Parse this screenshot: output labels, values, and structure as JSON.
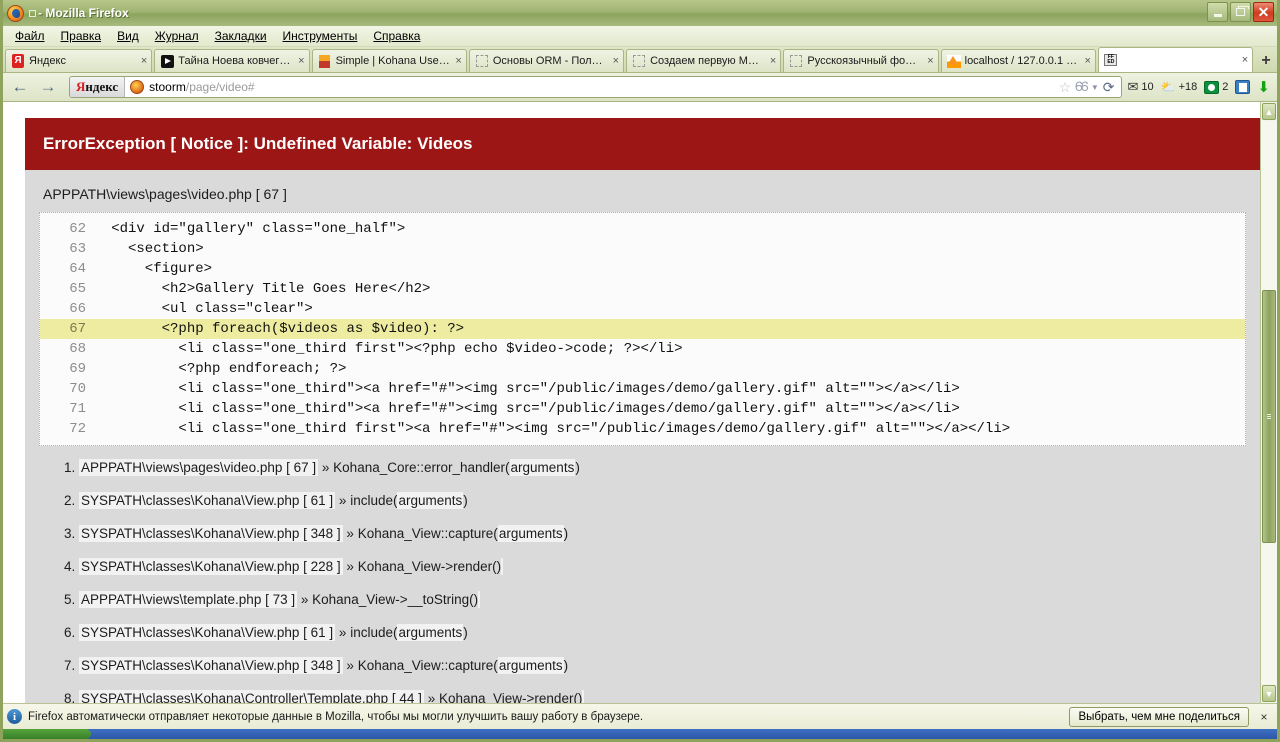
{
  "window": {
    "title": "□ - Mozilla Firefox",
    "title_doc": "□",
    "title_rest": "- Mozilla Firefox",
    "minimize_label": "Minimize",
    "maximize_label": "Restore",
    "close_label": "Close"
  },
  "menu": [
    {
      "label": "Файл"
    },
    {
      "label": "Правка"
    },
    {
      "label": "Вид"
    },
    {
      "label": "Журнал"
    },
    {
      "label": "Закладки"
    },
    {
      "label": "Инструменты"
    },
    {
      "label": "Справка"
    }
  ],
  "tabs": [
    {
      "label": "Яндекс",
      "icon": "yandex-favicon",
      "active": false,
      "close": "×"
    },
    {
      "label": "Тайна Ноева ковчег…",
      "icon": "video-favicon",
      "active": false,
      "close": "×"
    },
    {
      "label": "Simple | Kohana User …",
      "icon": "kohana-favicon",
      "active": false,
      "close": "×"
    },
    {
      "label": "Основы ORM - Полу…",
      "icon": "blank-favicon",
      "active": false,
      "close": "×"
    },
    {
      "label": "Создаем первую Mo…",
      "icon": "blank-favicon",
      "active": false,
      "close": "×"
    },
    {
      "label": "Русскоязычный фор…",
      "icon": "blank-favicon",
      "active": false,
      "close": "×"
    },
    {
      "label": "localhost / 127.0.0.1 …",
      "icon": "phpmyadmin-favicon",
      "active": false,
      "close": "×"
    },
    {
      "label": "",
      "icon": "ffed-favicon",
      "active": true,
      "close": "×"
    }
  ],
  "newtab_label": "+",
  "nav": {
    "back_icon": "←",
    "forward_icon": "→",
    "search_engine": "Яндекс",
    "search_engine_first": "Я",
    "search_engine_rest": "ндекс",
    "url_host": "stoorm",
    "url_path": "/page/video#",
    "url_full": "stoorm/page/video#",
    "star_icon": "☆",
    "glasses_icon": "👓",
    "caret_icon": "▼",
    "reload_icon": "⟳"
  },
  "toolbar_extras": {
    "mail_icon": "✉",
    "mail_count": "10",
    "weather_icon": "⛅",
    "weather_value": "+18",
    "green_count": "2",
    "download_icon": "⬇"
  },
  "error": {
    "heading": "ErrorException [ Notice ]: Undefined Variable: Videos",
    "file_path": "APPPATH\\views\\pages\\video.php [ 67 ]",
    "header_bg": "#9c1616",
    "body_bg": "#dadada",
    "highlight_bg": "#eeeca0"
  },
  "code": {
    "lines": [
      {
        "no": "62",
        "text": "   <div id=\"gallery\" class=\"one_half\">",
        "highlight": false
      },
      {
        "no": "63",
        "text": "     <section>",
        "highlight": false
      },
      {
        "no": "64",
        "text": "       <figure>",
        "highlight": false
      },
      {
        "no": "65",
        "text": "         <h2>Gallery Title Goes Here</h2>",
        "highlight": false
      },
      {
        "no": "66",
        "text": "         <ul class=\"clear\">",
        "highlight": false
      },
      {
        "no": "67",
        "text": "         <?php foreach($videos as $video): ?>",
        "highlight": true
      },
      {
        "no": "68",
        "text": "           <li class=\"one_third first\"><?php echo $video->code; ?></li>",
        "highlight": false
      },
      {
        "no": "69",
        "text": "           <?php endforeach; ?>",
        "highlight": false
      },
      {
        "no": "70",
        "text": "           <li class=\"one_third\"><a href=\"#\"><img src=\"/public/images/demo/gallery.gif\" alt=\"\"></a></li>",
        "highlight": false
      },
      {
        "no": "71",
        "text": "           <li class=\"one_third\"><a href=\"#\"><img src=\"/public/images/demo/gallery.gif\" alt=\"\"></a></li>",
        "highlight": false
      },
      {
        "no": "72",
        "text": "           <li class=\"one_third first\"><a href=\"#\"><img src=\"/public/images/demo/gallery.gif\" alt=\"\"></a></li>",
        "highlight": false
      }
    ]
  },
  "trace": [
    {
      "num": "1.",
      "path": "APPPATH\\views\\pages\\video.php [ 67 ]",
      "sep": "»",
      "fn_pre": "Kohana_Core::error_handler(",
      "fn_arg": "arguments",
      "fn_post": ")"
    },
    {
      "num": "2.",
      "path": "SYSPATH\\classes\\Kohana\\View.php [ 61 ]",
      "sep": "»",
      "fn_pre": "include(",
      "fn_arg": "arguments",
      "fn_post": ")"
    },
    {
      "num": "3.",
      "path": "SYSPATH\\classes\\Kohana\\View.php [ 348 ]",
      "sep": "»",
      "fn_pre": "Kohana_View::capture(",
      "fn_arg": "arguments",
      "fn_post": ")"
    },
    {
      "num": "4.",
      "path": "SYSPATH\\classes\\Kohana\\View.php [ 228 ]",
      "sep": "»",
      "fn_pre": "Kohana_View->render()",
      "fn_arg": "",
      "fn_post": ""
    },
    {
      "num": "5.",
      "path": "APPPATH\\views\\template.php [ 73 ]",
      "sep": "»",
      "fn_pre": "Kohana_View->__toString()",
      "fn_arg": "",
      "fn_post": ""
    },
    {
      "num": "6.",
      "path": "SYSPATH\\classes\\Kohana\\View.php [ 61 ]",
      "sep": "»",
      "fn_pre": "include(",
      "fn_arg": "arguments",
      "fn_post": ")"
    },
    {
      "num": "7.",
      "path": "SYSPATH\\classes\\Kohana\\View.php [ 348 ]",
      "sep": "»",
      "fn_pre": "Kohana_View::capture(",
      "fn_arg": "arguments",
      "fn_post": ")"
    },
    {
      "num": "8.",
      "path": "SYSPATH\\classes\\Kohana\\Controller\\Template.php [ 44 ]",
      "sep": "»",
      "fn_pre": "Kohana_View->render()",
      "fn_arg": "",
      "fn_post": ""
    }
  ],
  "notification": {
    "icon_letter": "i",
    "text": "Firefox автоматически отправляет некоторые данные в Mozilla, чтобы мы могли улучшить вашу работу в браузере.",
    "button_label": "Выбрать, чем мне поделиться",
    "close_label": "×"
  },
  "scrollbar": {
    "up_icon": "▲",
    "down_icon": "▼"
  }
}
